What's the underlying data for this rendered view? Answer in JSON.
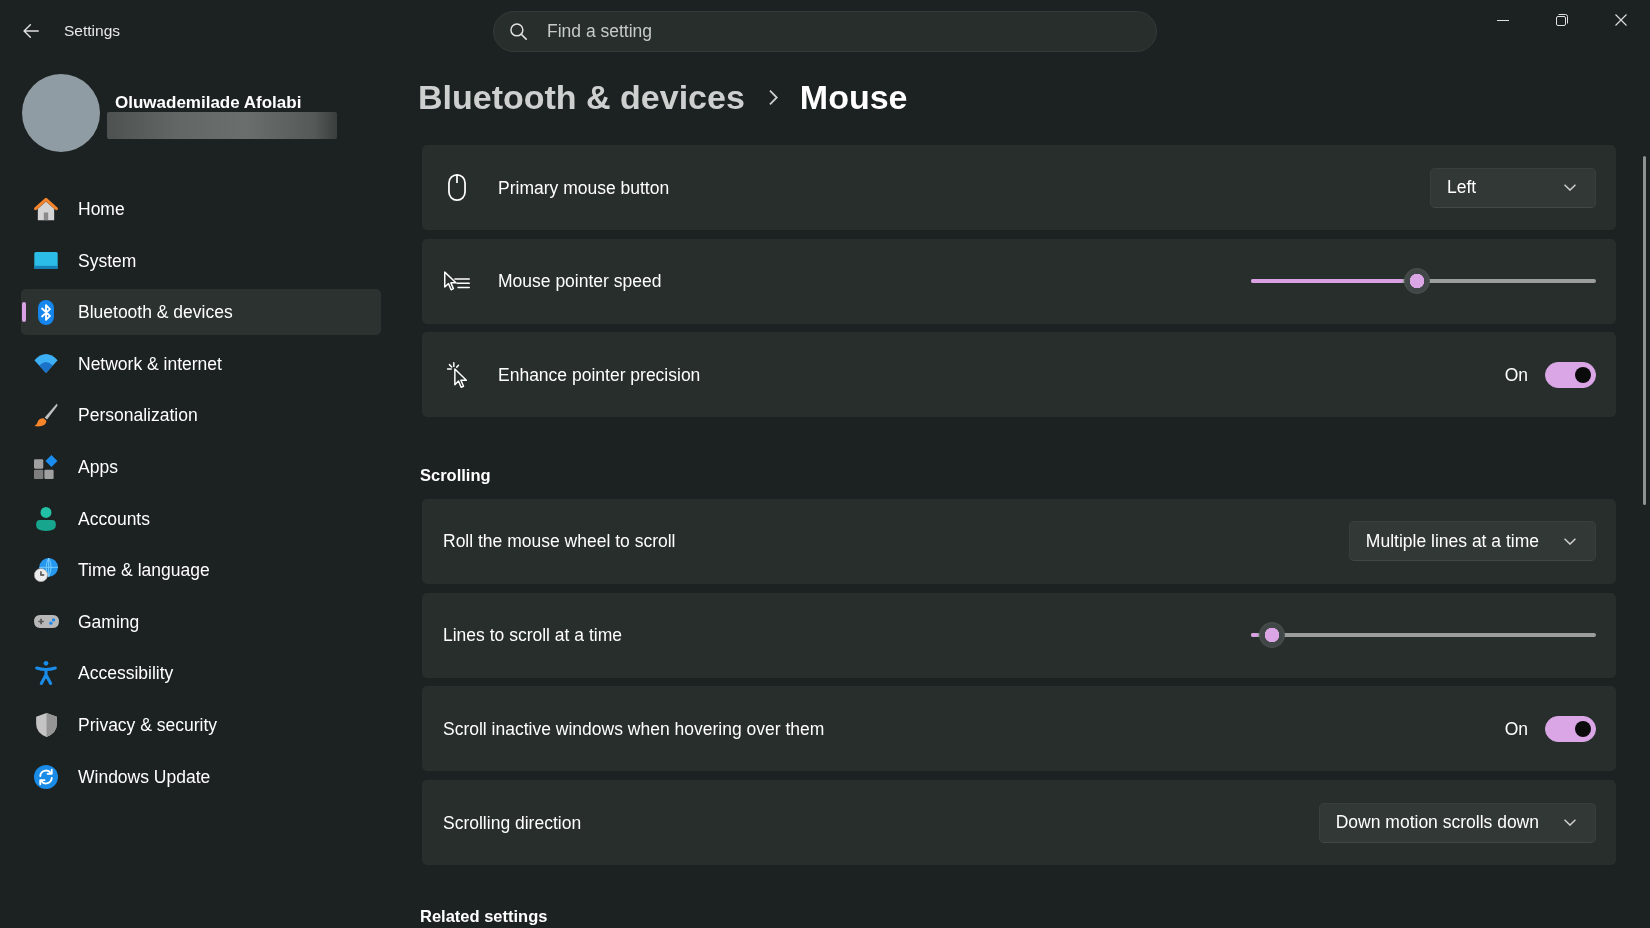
{
  "window": {
    "title": "Settings"
  },
  "search": {
    "placeholder": "Find a setting"
  },
  "profile": {
    "name": "Oluwademilade Afolabi"
  },
  "sidebar": {
    "items": [
      {
        "label": "Home",
        "selected": false
      },
      {
        "label": "System",
        "selected": false
      },
      {
        "label": "Bluetooth & devices",
        "selected": true
      },
      {
        "label": "Network & internet",
        "selected": false
      },
      {
        "label": "Personalization",
        "selected": false
      },
      {
        "label": "Apps",
        "selected": false
      },
      {
        "label": "Accounts",
        "selected": false
      },
      {
        "label": "Time & language",
        "selected": false
      },
      {
        "label": "Gaming",
        "selected": false
      },
      {
        "label": "Accessibility",
        "selected": false
      },
      {
        "label": "Privacy & security",
        "selected": false
      },
      {
        "label": "Windows Update",
        "selected": false
      }
    ]
  },
  "breadcrumb": {
    "parent": "Bluetooth & devices",
    "current": "Mouse"
  },
  "mouse_settings": [
    {
      "kind": "dropdown",
      "label": "Primary mouse button",
      "value": "Left"
    },
    {
      "kind": "slider",
      "label": "Mouse pointer speed",
      "level": 0.48
    },
    {
      "kind": "toggle",
      "label": "Enhance pointer precision",
      "on": true,
      "status": "On"
    }
  ],
  "scrolling": {
    "heading": "Scrolling",
    "rows": [
      {
        "kind": "dropdown",
        "label": "Roll the mouse wheel to scroll",
        "value": "Multiple lines at a time"
      },
      {
        "kind": "slider",
        "label": "Lines to scroll at a time",
        "level": 0.06
      },
      {
        "kind": "toggle",
        "label": "Scroll inactive windows when hovering over them",
        "on": true,
        "status": "On"
      },
      {
        "kind": "dropdown",
        "label": "Scrolling direction",
        "value": "Down motion scrolls down"
      }
    ]
  },
  "related_settings": {
    "heading": "Related settings"
  }
}
